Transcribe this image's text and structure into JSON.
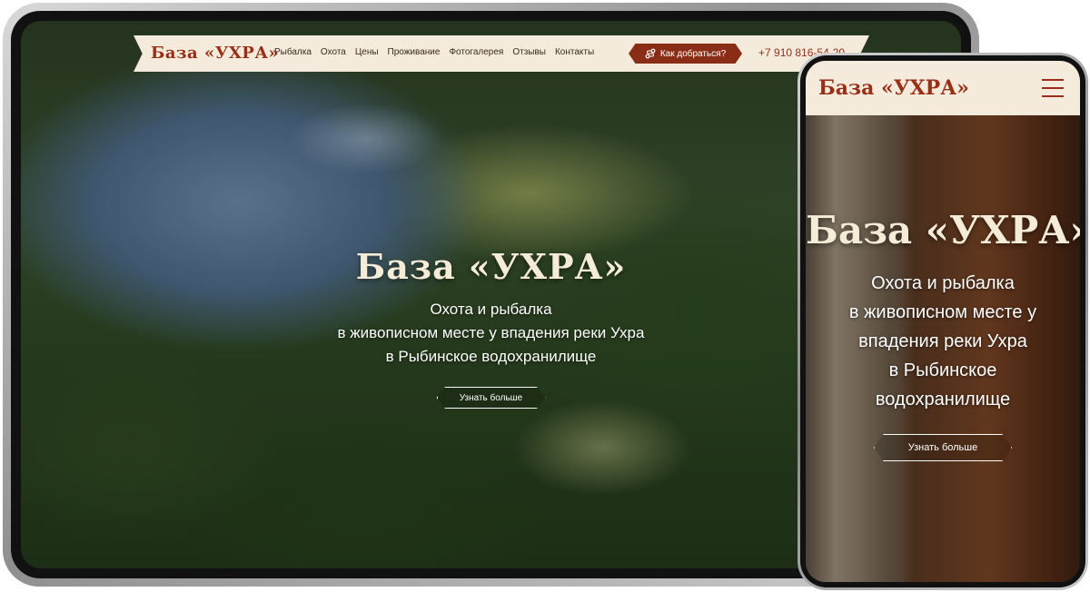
{
  "site": {
    "logo": "База «УХРА»",
    "hero_title": "База «УХРА»",
    "hero_button": "Узнать больше"
  },
  "desktop": {
    "nav": [
      "Рыбалка",
      "Охота",
      "Цены",
      "Проживание",
      "Фотогалерея",
      "Отзывы",
      "Контакты"
    ],
    "cta": "Как добраться?",
    "phone": "+7 910 816-54-20",
    "hero_lines": [
      "Охота и рыбалка",
      "в живописном месте у впадения реки Ухра",
      "в Рыбинское водохранилище"
    ]
  },
  "mobile": {
    "hero_lines": [
      "Охота и рыбалка",
      "в живописном месте у",
      "впадения реки Ухра",
      "в Рыбинское",
      "водохранилище"
    ]
  },
  "colors": {
    "brand": "#9a2f18",
    "cream": "#f4ebdc",
    "cta": "#8a2d16"
  }
}
